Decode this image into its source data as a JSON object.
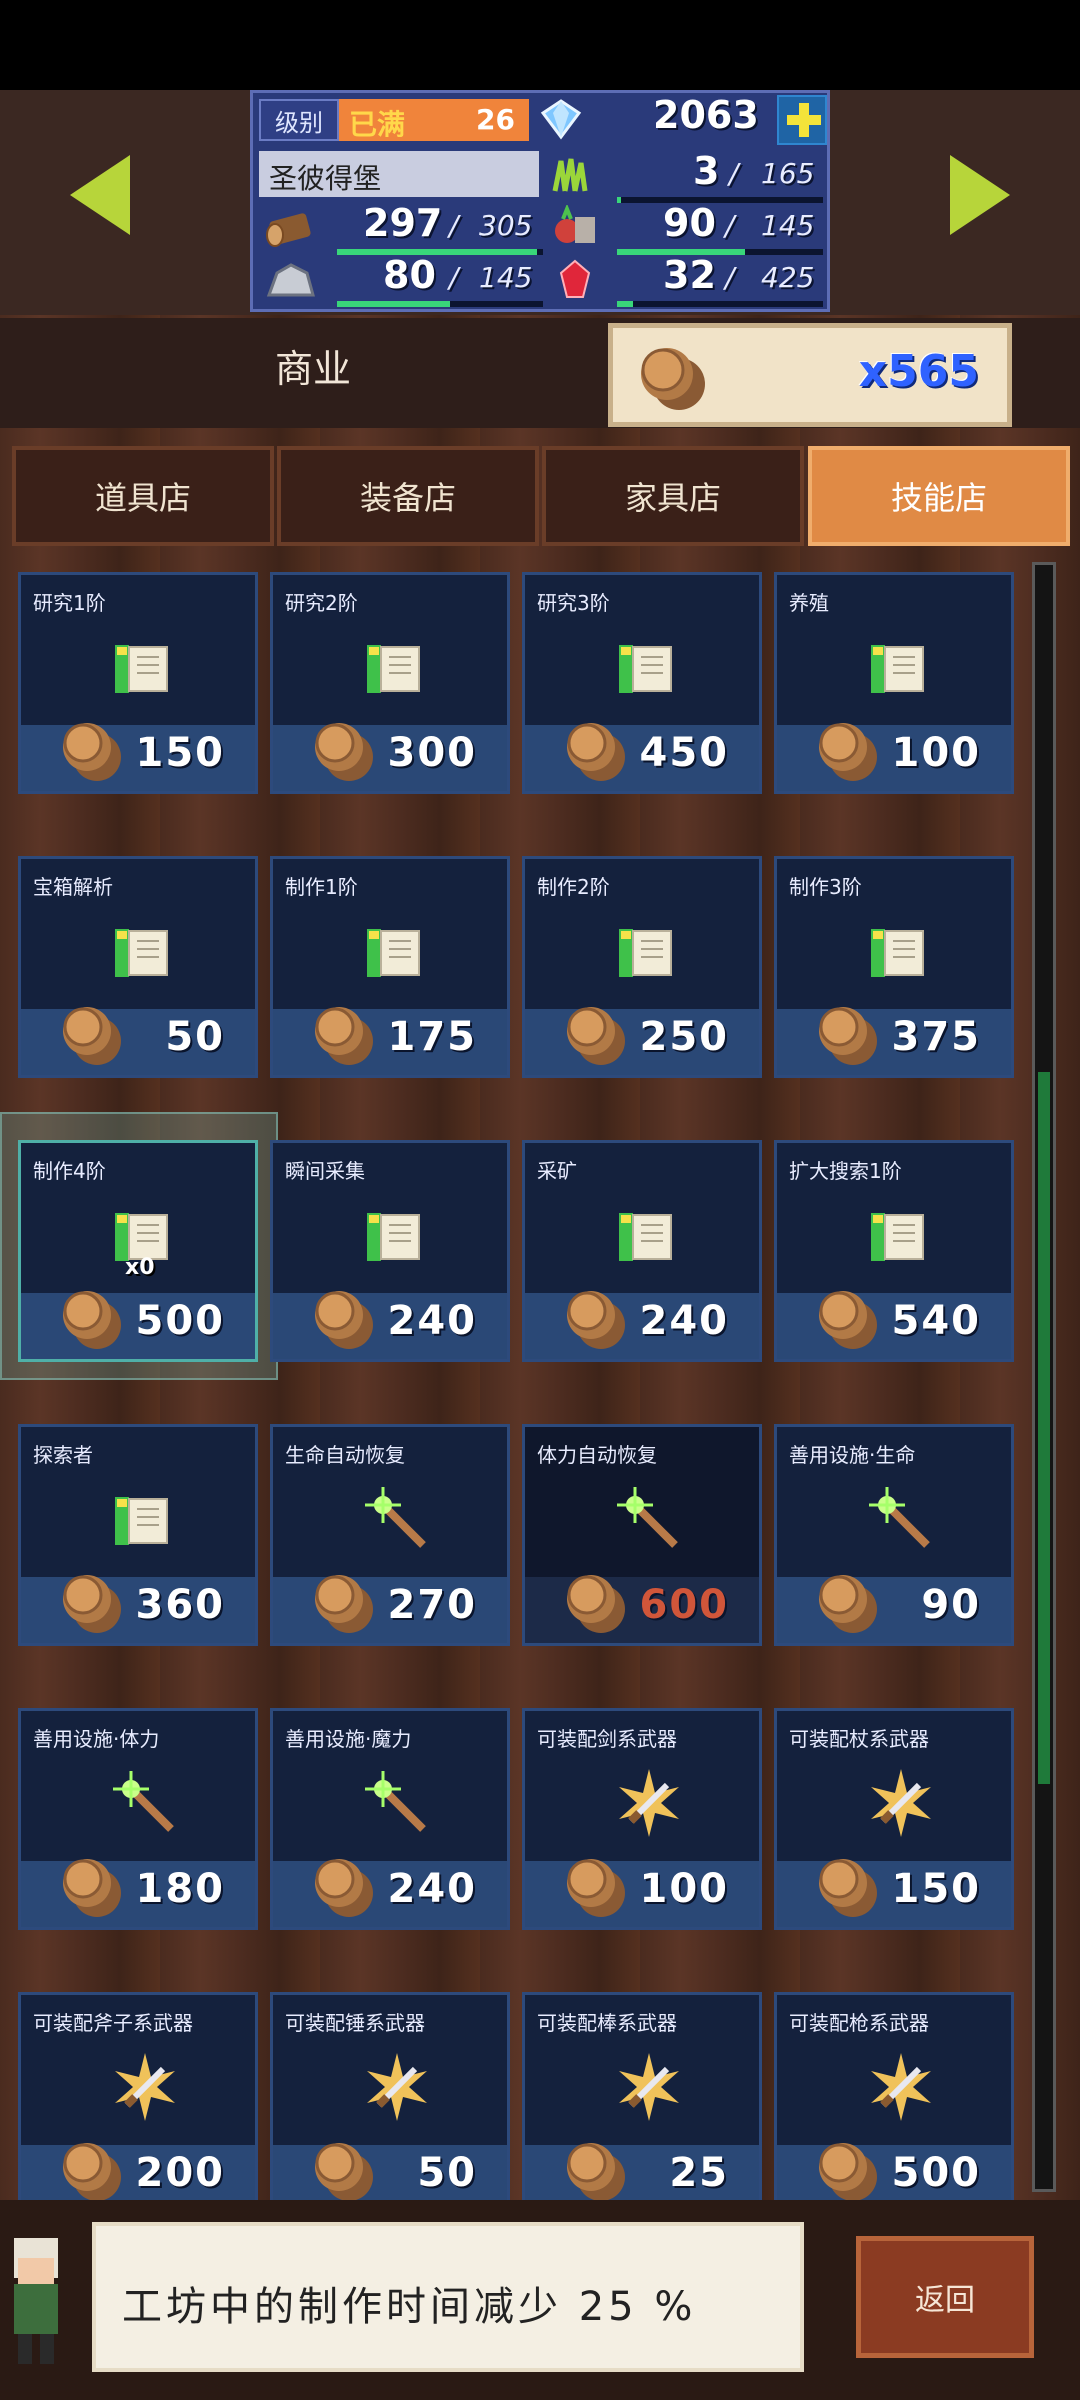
{
  "hud": {
    "level_label": "级别",
    "level_status": "已满",
    "level_value": "26",
    "gems": "2063",
    "town_name": "圣彼得堡",
    "food": {
      "value": "3",
      "max": "165",
      "fill": 0.02
    },
    "wood": {
      "value": "297",
      "max": "305",
      "fill": 0.97
    },
    "ore": {
      "value": "80",
      "max": "145",
      "fill": 0.55
    },
    "veg": {
      "value": "90",
      "max": "145",
      "fill": 0.62
    },
    "ruby": {
      "value": "32",
      "max": "425",
      "fill": 0.08
    }
  },
  "commerce": {
    "title": "商业",
    "coins": "x565"
  },
  "tabs": [
    "道具店",
    "装备店",
    "家具店",
    "技能店"
  ],
  "active_tab": 3,
  "items": [
    {
      "title": "研究1阶",
      "icon": "book-icon",
      "price": "150"
    },
    {
      "title": "研究2阶",
      "icon": "book-icon",
      "price": "300"
    },
    {
      "title": "研究3阶",
      "icon": "book-icon",
      "price": "450"
    },
    {
      "title": "养殖",
      "icon": "book-icon",
      "price": "100"
    },
    {
      "title": "宝箱解析",
      "icon": "book-icon",
      "price": "50"
    },
    {
      "title": "制作1阶",
      "icon": "book-icon",
      "price": "175"
    },
    {
      "title": "制作2阶",
      "icon": "book-icon",
      "price": "250"
    },
    {
      "title": "制作3阶",
      "icon": "book-icon",
      "price": "375"
    },
    {
      "title": "制作4阶",
      "icon": "book-icon",
      "price": "500",
      "badge": "x0"
    },
    {
      "title": "瞬间采集",
      "icon": "book-icon",
      "price": "240"
    },
    {
      "title": "采矿",
      "icon": "book-icon",
      "price": "240"
    },
    {
      "title": "扩大搜索1阶",
      "icon": "book-icon",
      "price": "540"
    },
    {
      "title": "探索者",
      "icon": "book-icon",
      "price": "360"
    },
    {
      "title": "生命自动恢复",
      "icon": "wand-icon",
      "price": "270"
    },
    {
      "title": "体力自动恢复",
      "icon": "wand-icon",
      "price": "600",
      "disabled": true
    },
    {
      "title": "善用设施·生命",
      "icon": "wand-icon",
      "price": "90"
    },
    {
      "title": "善用设施·体力",
      "icon": "wand-icon",
      "price": "180"
    },
    {
      "title": "善用设施·魔力",
      "icon": "wand-icon",
      "price": "240"
    },
    {
      "title": "可装配剑系武器",
      "icon": "sword-burst-icon",
      "price": "100"
    },
    {
      "title": "可装配杖系武器",
      "icon": "sword-burst-icon",
      "price": "150"
    },
    {
      "title": "可装配斧子系武器",
      "icon": "sword-burst-icon",
      "price": "200"
    },
    {
      "title": "可装配锤系武器",
      "icon": "sword-burst-icon",
      "price": "50"
    },
    {
      "title": "可装配棒系武器",
      "icon": "sword-burst-icon",
      "price": "25"
    },
    {
      "title": "可装配枪系武器",
      "icon": "sword-burst-icon",
      "price": "500"
    }
  ],
  "selected_index": 8,
  "message": "工坊中的制作时间减少 25 %",
  "back_label": "返回",
  "colors": {
    "accent_tab": "#e08a45",
    "card_bg": "#14213d",
    "price_disabled": "#d0563a",
    "bar": "#39d67a"
  }
}
